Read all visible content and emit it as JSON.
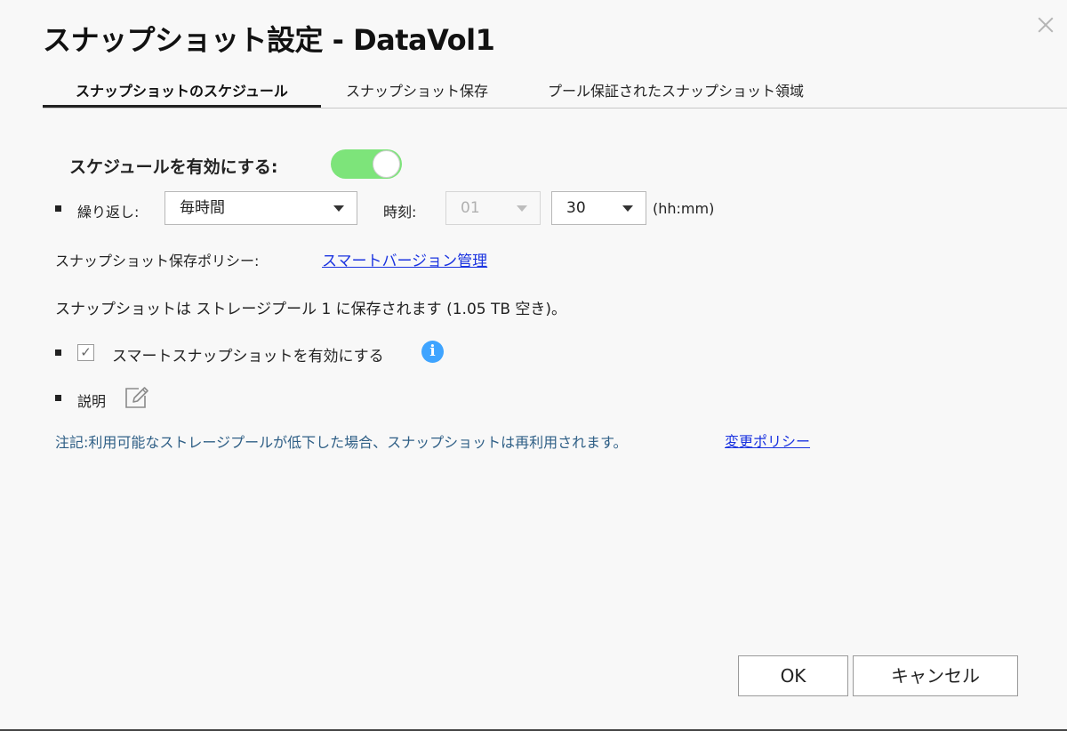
{
  "window": {
    "title": "スナップショット設定 - DataVol1"
  },
  "tabs": [
    {
      "label": "スナップショットのスケジュール",
      "active": true
    },
    {
      "label": "スナップショット保存",
      "active": false
    },
    {
      "label": "プール保証されたスナップショット領域",
      "active": false
    }
  ],
  "schedule": {
    "enable_label": "スケジュールを有効にする:",
    "enabled": true,
    "toggle_color": "#7de47a",
    "repeat_label": "繰り返し:",
    "repeat_value": "毎時間",
    "time_label": "時刻:",
    "hour_value": "01",
    "hour_disabled": true,
    "minute_value": "30",
    "time_format": "(hh:mm)"
  },
  "policy": {
    "label": "スナップショット保存ポリシー:",
    "link": "スマートバージョン管理"
  },
  "storage_info": "スナップショットは ストレージプール 1 に保存されます (1.05 TB 空き)。",
  "smart_snapshot": {
    "label": "スマートスナップショットを有効にする",
    "checked": true,
    "check_glyph": "✓",
    "info_glyph": "i"
  },
  "description": {
    "label": "説明"
  },
  "note": {
    "text": "注記:利用可能なストレージプールが低下した場合、スナップショットは再利用されます。",
    "link": "変更ポリシー",
    "color": "#2f5f86"
  },
  "buttons": {
    "ok": "OK",
    "cancel": "キャンセル"
  }
}
